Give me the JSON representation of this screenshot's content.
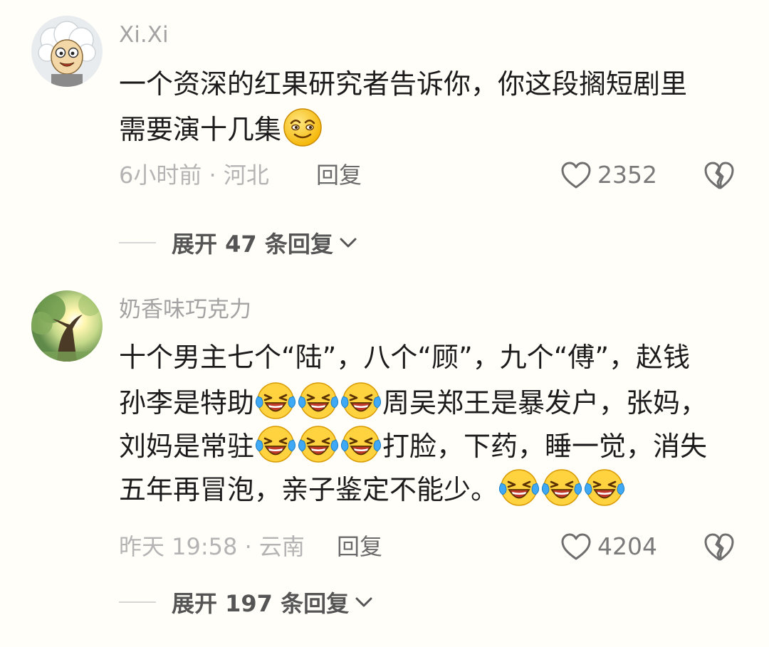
{
  "comments": [
    {
      "username": "Xi.Xi",
      "avatar_icon": "goat-cartoon-avatar",
      "content_lines": [
        [
          {
            "text": "一个资深的红果研究者告诉你，你这段搁短剧里"
          }
        ],
        [
          {
            "text": "需要演十几集"
          },
          {
            "emoji": "smirk-face-emoji"
          }
        ]
      ],
      "time_location": "6小时前 · 河北",
      "reply_label": "回复",
      "like_count": "2352",
      "expand_label": "展开 47 条回复"
    },
    {
      "username": "奶香味巧克力",
      "avatar_icon": "tree-sunlight-avatar",
      "content_lines": [
        [
          {
            "text": "十个男主七个“陆”，八个“顾”，九个“傅”，赵钱"
          }
        ],
        [
          {
            "text": "孙李是特助"
          },
          {
            "emoji": "laugh-cry-emoji"
          },
          {
            "emoji": "laugh-cry-emoji"
          },
          {
            "emoji": "laugh-cry-emoji"
          },
          {
            "text": "周吴郑王是暴发户，张妈，"
          }
        ],
        [
          {
            "text": "刘妈是常驻"
          },
          {
            "emoji": "laugh-cry-emoji"
          },
          {
            "emoji": "laugh-cry-emoji"
          },
          {
            "emoji": "laugh-cry-emoji"
          },
          {
            "text": "打脸，下药，睡一觉，消失"
          }
        ],
        [
          {
            "text": "五年再冒泡，亲子鉴定不能少。"
          },
          {
            "emoji": "laugh-cry-emoji"
          },
          {
            "emoji": "laugh-cry-emoji"
          },
          {
            "emoji": "laugh-cry-emoji"
          }
        ]
      ],
      "time_location": "昨天 19:58 · 云南",
      "reply_label": "回复",
      "like_count": "4204",
      "expand_label": "展开 197 条回复"
    }
  ],
  "colors": {
    "background": "#fffef9",
    "username": "#a3a3a3",
    "content": "#1c1c1c",
    "meta": "#b4b4b4"
  }
}
